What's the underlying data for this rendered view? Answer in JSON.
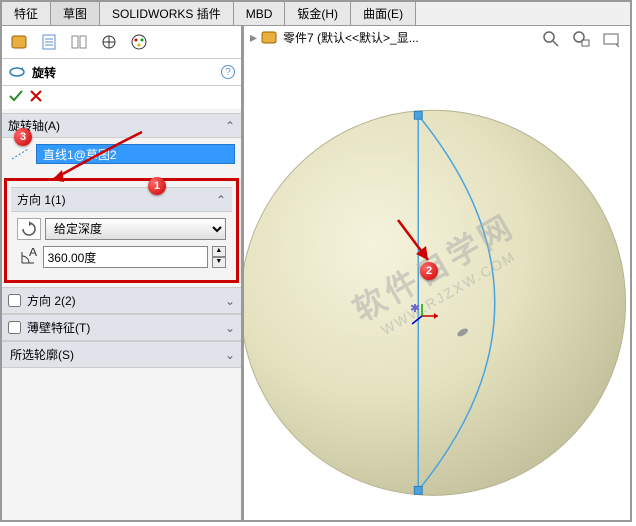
{
  "tabs": {
    "t0": "特征",
    "t1": "草图",
    "t2": "SOLIDWORKS 插件",
    "t3": "MBD",
    "t4": "钣金(H)",
    "t5": "曲面(E)"
  },
  "feature": {
    "title": "旋转"
  },
  "axis": {
    "label": "旋转轴(A)",
    "value": "直线1@草图2"
  },
  "dir1": {
    "label": "方向 1(1)",
    "type": "给定深度",
    "angle": "360.00度"
  },
  "dir2": {
    "label": "方向 2(2)"
  },
  "thin": {
    "label": "薄壁特征(T)"
  },
  "contour": {
    "label": "所选轮廓(S)"
  },
  "breadcrumb": {
    "part": "零件7 (默认<<默认>_显..."
  },
  "markers": {
    "m1": "1",
    "m2": "2",
    "m3": "3"
  },
  "watermark": {
    "line1": "软件自学网",
    "line2": "WWW.RJZXW.COM"
  }
}
